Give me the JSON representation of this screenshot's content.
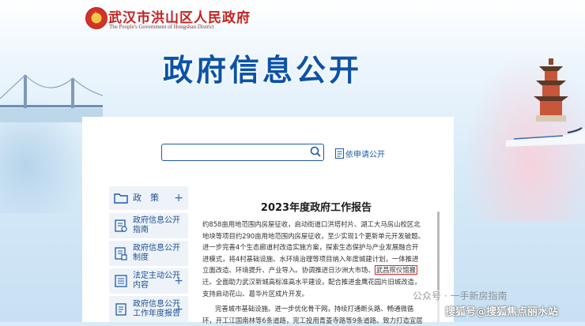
{
  "header": {
    "site_title": "武汉市洪山区人民政府",
    "site_subtitle": "The People's Government of Hongshan District",
    "main_title": "政府信息公开"
  },
  "search": {
    "value": "",
    "apply_label": "依申请公开"
  },
  "sidebar": {
    "items": [
      {
        "label": "政　策",
        "icon": "folder-icon"
      },
      {
        "label": "政府信息公开指南",
        "icon": "guide-icon"
      },
      {
        "label": "政府信息公开制度",
        "icon": "rules-icon"
      },
      {
        "label": "法定主动公开内容",
        "icon": "list-icon"
      },
      {
        "label": "政府信息公开工作年度报告",
        "icon": "report-icon"
      }
    ]
  },
  "article": {
    "title": "2023年度政府工作报告",
    "lines": [
      "约858亩用地范围内房屋征收，启动街道口洪塔村片、湖工大马房山校区北",
      "地块等项目约290亩用地范围内房屋征收，至少实现1个更新单元开发破题。",
      "进一步完善4个生态廊道村改造实施方案，探索生态保护与产业发展融合开",
      "进模式，将4村基础设施、水环境治理等项目纳入年度城建计划，一体推进",
      "立面改造、环境提升、产业导入。协调推进日沙洲大市场、"
    ],
    "highlight": "武昌殡仪馆搬",
    "lines_after": [
      "迁。全面助力武汉新城高标准高水平建设，配合推进金鹰花园片旧城改造，",
      "支持启动花山、葛华片区成片开发。"
    ],
    "paragraph2": [
      "完善城市基础设施。进一步优化骨干网，持续打通断头路、畅通微循",
      "环，开工江国南林等6条道路，完工投用青菱寺路等9条道路。致力打造宜居"
    ]
  },
  "watermark": {
    "line1": "公众号 · 一手新房指南",
    "line2": "搜狐号@搜狐焦点丽水站"
  }
}
